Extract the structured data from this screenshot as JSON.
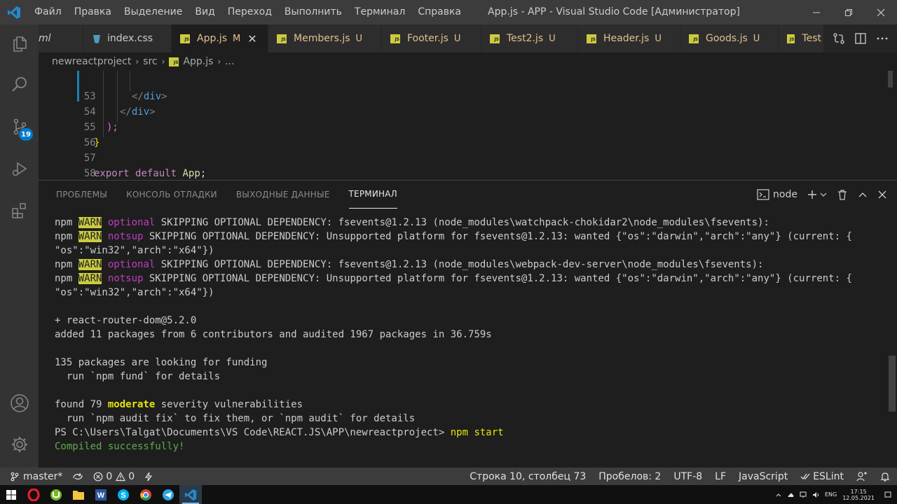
{
  "titlebar": {
    "menu": [
      "Файл",
      "Правка",
      "Выделение",
      "Вид",
      "Переход",
      "Выполнить",
      "Терминал",
      "Справка"
    ],
    "title": "App.js - APP - Visual Studio Code [Администратор]"
  },
  "activity": {
    "source_control_badge": "19"
  },
  "tabs": [
    {
      "label": "ml",
      "status": "",
      "icon": "xml-icon"
    },
    {
      "label": "index.css",
      "status": "",
      "icon": "css-icon"
    },
    {
      "label": "App.js",
      "status": "M",
      "icon": "js-icon",
      "active": true
    },
    {
      "label": "Members.js",
      "status": "U",
      "icon": "js-icon"
    },
    {
      "label": "Footer.js",
      "status": "U",
      "icon": "js-icon"
    },
    {
      "label": "Test2.js",
      "status": "U",
      "icon": "js-icon"
    },
    {
      "label": "Header.js",
      "status": "U",
      "icon": "js-icon"
    },
    {
      "label": "Goods.js",
      "status": "U",
      "icon": "js-icon"
    },
    {
      "label": "Test",
      "status": "",
      "icon": "js-icon"
    }
  ],
  "breadcrumb": [
    "newreactproject",
    "src",
    "App.js",
    "..."
  ],
  "editor": {
    "lines": [
      {
        "n": "53"
      },
      {
        "n": "54",
        "tag": "div"
      },
      {
        "n": "55",
        "tag": "div"
      },
      {
        "n": "56",
        "text": ");"
      },
      {
        "n": "57",
        "text": "}"
      },
      {
        "n": "58",
        "text": ""
      },
      {
        "n": "59",
        "kw1": "export",
        "kw2": "default",
        "ident": "App",
        "punct": ";"
      }
    ]
  },
  "panel": {
    "tabs": [
      "ПРОБЛЕМЫ",
      "КОНСОЛЬ ОТЛАДКИ",
      "ВЫХОДНЫЕ ДАННЫЕ",
      "ТЕРМИНАЛ"
    ],
    "terminal_name": "node",
    "terminal": {
      "warn1": {
        "npm": "npm ",
        "warn": "WARN",
        "kind": "optional",
        "text": " SKIPPING OPTIONAL DEPENDENCY: fsevents@1.2.13 (node_modules\\watchpack-chokidar2\\node_modules\\fsevents):"
      },
      "warn2": {
        "npm": "npm ",
        "warn": "WARN",
        "kind": "notsup",
        "text": " SKIPPING OPTIONAL DEPENDENCY: Unsupported platform for fsevents@1.2.13: wanted {\"os\":\"darwin\",\"arch\":\"any\"} (current: {"
      },
      "warn2b": "\"os\":\"win32\",\"arch\":\"x64\"})",
      "warn3": {
        "npm": "npm ",
        "warn": "WARN",
        "kind": "optional",
        "text": " SKIPPING OPTIONAL DEPENDENCY: fsevents@1.2.13 (node_modules\\webpack-dev-server\\node_modules\\fsevents):"
      },
      "warn4": {
        "npm": "npm ",
        "warn": "WARN",
        "kind": "notsup",
        "text": " SKIPPING OPTIONAL DEPENDENCY: Unsupported platform for fsevents@1.2.13: wanted {\"os\":\"darwin\",\"arch\":\"any\"} (current: {"
      },
      "warn4b": "\"os\":\"win32\",\"arch\":\"x64\"})",
      "added_pkg": "+ react-router-dom@5.2.0",
      "added": "added 11 packages from 6 contributors and audited 1967 packages in 36.759s",
      "funding": "135 packages are looking for funding",
      "funding2": "  run `npm fund` for details",
      "found_pre": "found 79 ",
      "found_mod": "moderate",
      "found_post": " severity vulnerabilities",
      "audit": "  run `npm audit fix` to fix them, or `npm audit` for details",
      "prompt": "PS C:\\Users\\Talgat\\Documents\\VS Code\\REACT.JS\\APP\\newreactproject> ",
      "command": "npm start",
      "compiled": "Compiled successfully!"
    }
  },
  "statusbar": {
    "branch": "master*",
    "errors": "0",
    "warnings": "0",
    "position": "Строка 10, столбец 73",
    "spaces": "Пробелов: 2",
    "encoding": "UTF-8",
    "eol": "LF",
    "language": "JavaScript",
    "eslint": "ESLint"
  },
  "taskbar": {
    "lang": "ENG",
    "time": "17:15",
    "date": "12.05.2021"
  },
  "colors": {
    "accent": "#007acc",
    "warn_bg": "#cbcb41",
    "modified": "#e2c08d"
  }
}
